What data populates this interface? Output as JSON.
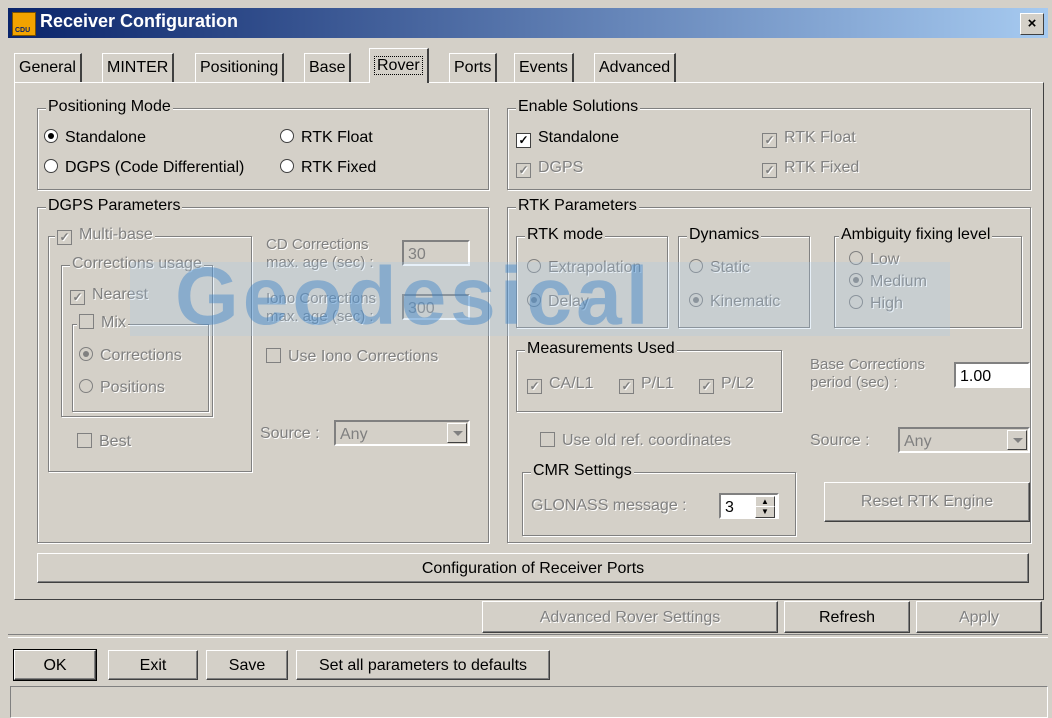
{
  "window": {
    "title": "Receiver Configuration",
    "icon_label": "CDU",
    "close": "×"
  },
  "tabs": [
    {
      "label": "General"
    },
    {
      "label": "MINTER"
    },
    {
      "label": "Positioning"
    },
    {
      "label": "Base"
    },
    {
      "label": "Rover",
      "active": true
    },
    {
      "label": "Ports"
    },
    {
      "label": "Events"
    },
    {
      "label": "Advanced"
    }
  ],
  "positioning_mode": {
    "title": "Positioning Mode",
    "options": [
      {
        "label": "Standalone",
        "selected": true
      },
      {
        "label": "RTK Float",
        "selected": false
      },
      {
        "label": "DGPS (Code Differential)",
        "selected": false
      },
      {
        "label": "RTK Fixed",
        "selected": false
      }
    ]
  },
  "enable_solutions": {
    "title": "Enable Solutions",
    "standalone": "Standalone",
    "rtk_float": "RTK Float",
    "dgps": "DGPS",
    "rtk_fixed": "RTK Fixed"
  },
  "dgps": {
    "title": "DGPS Parameters",
    "multi_base": "Multi-base",
    "corrections_usage": "Corrections usage",
    "nearest": "Nearest",
    "mix": "Mix",
    "corrections": "Corrections",
    "positions": "Positions",
    "best": "Best",
    "cd_label_1": "CD Corrections",
    "cd_label_2": "max. age (sec) :",
    "cd_value": "30",
    "iono_label_1": "Iono Corrections",
    "iono_label_2": "max. age (sec) :",
    "iono_value": "300",
    "use_iono": "Use Iono Corrections",
    "source_label": "Source :",
    "source_value": "Any"
  },
  "rtk": {
    "title": "RTK Parameters",
    "mode_title": "RTK mode",
    "extrapolation": "Extrapolation",
    "delay": "Delay",
    "dynamics_title": "Dynamics",
    "static": "Static",
    "kinematic": "Kinematic",
    "ambiguity_title": "Ambiguity fixing level",
    "low": "Low",
    "medium": "Medium",
    "high": "High",
    "measurements_title": "Measurements Used",
    "ca_l1": "CA/L1",
    "p_l1": "P/L1",
    "p_l2": "P/L2",
    "base_corr_1": "Base Corrections",
    "base_corr_2": "period (sec) :",
    "base_corr_value": "1.00",
    "use_old_ref": "Use old ref. coordinates",
    "source_label": "Source :",
    "source_value": "Any",
    "cmr_title": "CMR Settings",
    "glonass_label": "GLONASS message :",
    "glonass_value": "3",
    "reset_button": "Reset RTK Engine"
  },
  "config_ports_button": "Configuration of Receiver Ports",
  "advanced_rover_button": "Advanced Rover Settings",
  "refresh_button": "Refresh",
  "apply_button": "Apply",
  "watermark": "Geodesical",
  "footer": {
    "ok": "OK",
    "exit": "Exit",
    "save": "Save",
    "defaults": "Set all parameters to defaults"
  }
}
